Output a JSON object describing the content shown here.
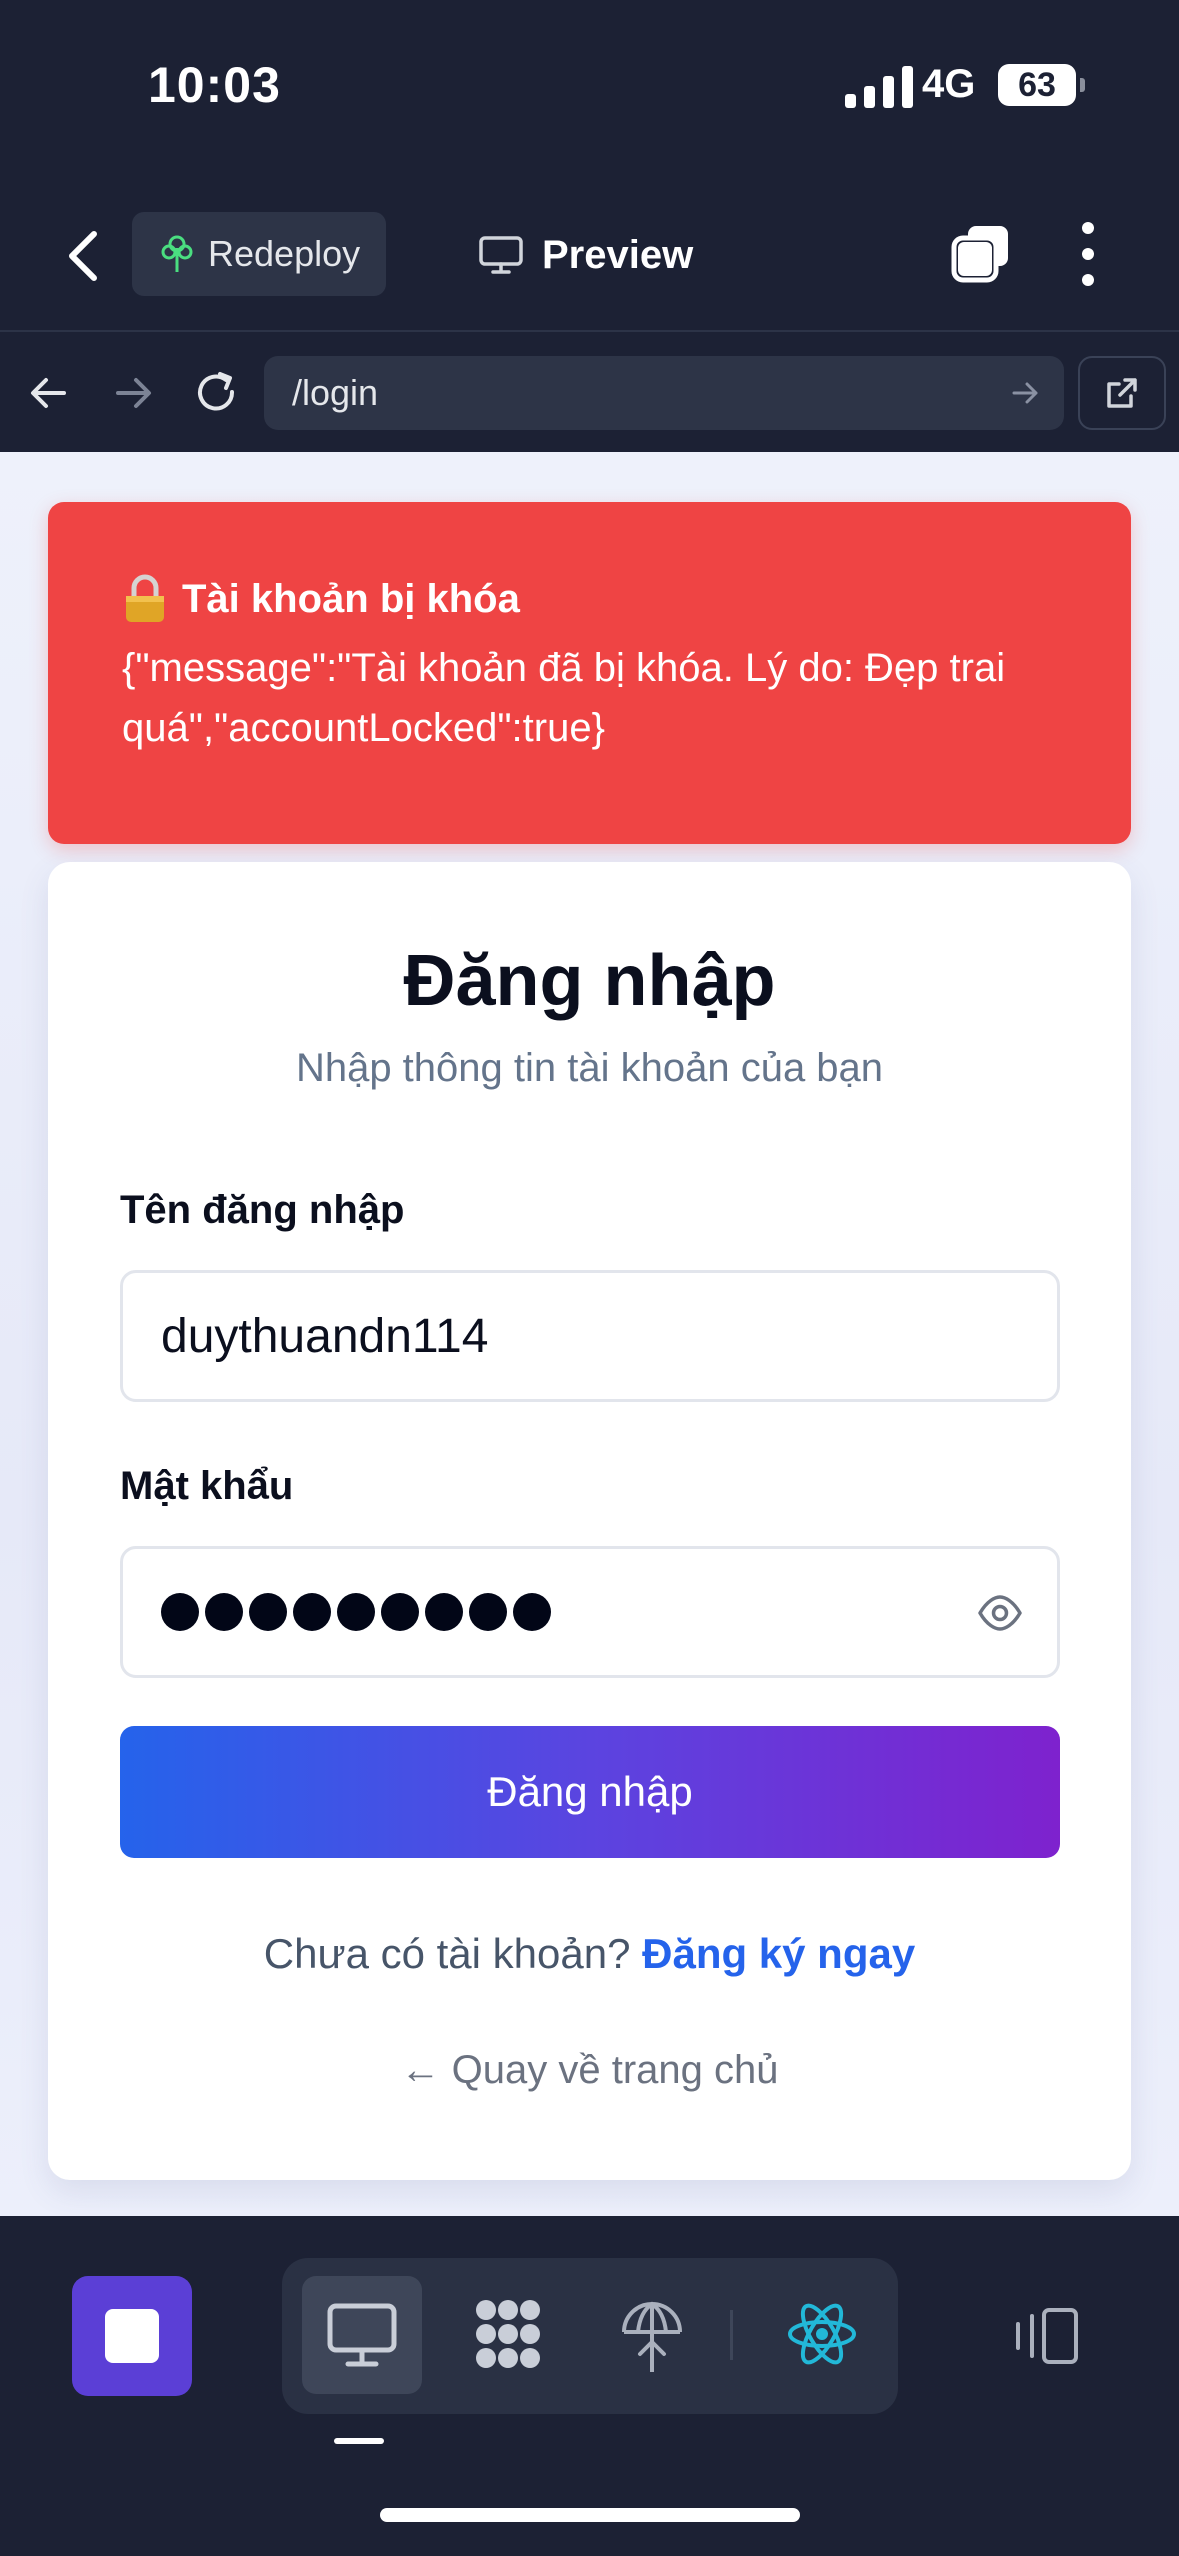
{
  "status_bar": {
    "time": "10:03",
    "network": "4G",
    "battery": "63"
  },
  "toolbar": {
    "redeploy_label": "Redeploy",
    "preview_label": "Preview"
  },
  "browser": {
    "url": "/login"
  },
  "alert": {
    "title": "Tài khoản bị khóa",
    "message": "{\"message\":\"Tài khoản đã bị khóa. Lý do: Đẹp trai quá\",\"accountLocked\":true}",
    "color": "#ef4444"
  },
  "login": {
    "title": "Đăng nhập",
    "subtitle": "Nhập thông tin tài khoản của bạn",
    "username_label": "Tên đăng nhập",
    "username_value": "duythuandn114",
    "password_label": "Mật khẩu",
    "password_length": 9,
    "submit_label": "Đăng nhập",
    "signup_prompt": "Chưa có tài khoản?",
    "signup_link": "Đăng ký ngay",
    "home_link": "← Quay về trang chủ"
  },
  "icons": [
    "back-icon",
    "tree-icon",
    "monitor-icon",
    "tabs-icon",
    "more-icon",
    "arrow-left-icon",
    "arrow-right-icon",
    "reload-icon",
    "external-link-icon",
    "lock-icon",
    "eye-icon",
    "stop-icon",
    "grid-icon",
    "deploy-icon",
    "react-icon",
    "panel-icon"
  ],
  "colors": {
    "background": "#1c2134",
    "accent_blue": "#2563eb",
    "accent_purple": "#7e22ce",
    "stop_button": "#5b3fd6"
  }
}
